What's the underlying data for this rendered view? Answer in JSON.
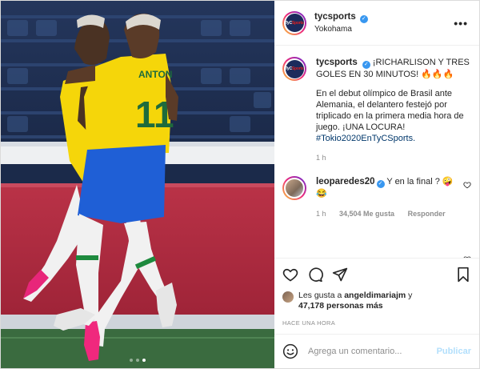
{
  "post": {
    "username": "tycsports",
    "location": "Yokohama",
    "avatar_text_a": "TyC",
    "avatar_text_b": "Sports",
    "media": {
      "carousel_count": 3,
      "active_index": 2,
      "jersey_name": "ANTON",
      "jersey_number": "11"
    },
    "caption": {
      "username": "tycsports",
      "headline": "¡RICHARLISON Y TRES GOLES EN 30 MINUTOS! 🔥🔥🔥",
      "body": "En el debut olímpico de Brasil ante Alemania, el delantero festejó por triplicado en la primera media hora de juego. ¡UNA LOCURA!",
      "hashtag": "#Tokio2020EnTyCSports.",
      "time": "1 h"
    },
    "comment": {
      "username": "leoparedes20",
      "text": "Y en la final ? 🤪",
      "emoji_line": "😂",
      "time": "1 h",
      "likes": "34,504 Me gusta",
      "reply": "Responder"
    },
    "likes": {
      "prefix": "Les gusta a",
      "user": "angeldimariajm",
      "connector": "y",
      "count": "47,178 personas más"
    },
    "time_ago": "HACE UNA HORA",
    "add_comment": {
      "placeholder": "Agrega un comentario...",
      "publish": "Publicar"
    },
    "colors": {
      "verified": "#3897f0",
      "hashtag": "#00376b",
      "publish": "#b2dffc",
      "jersey": "#f5d60a",
      "shorts": "#1f5fd6"
    },
    "icons": [
      "more-icon",
      "verified-icon",
      "heart-icon",
      "comment-icon",
      "share-icon",
      "bookmark-icon",
      "emoji-icon"
    ]
  }
}
